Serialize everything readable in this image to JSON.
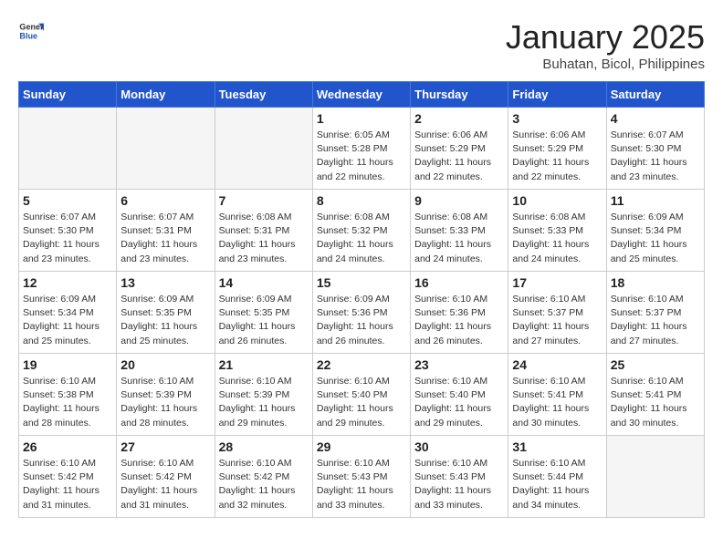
{
  "header": {
    "logo_general": "General",
    "logo_blue": "Blue",
    "title": "January 2025",
    "subtitle": "Buhatan, Bicol, Philippines"
  },
  "weekdays": [
    "Sunday",
    "Monday",
    "Tuesday",
    "Wednesday",
    "Thursday",
    "Friday",
    "Saturday"
  ],
  "weeks": [
    [
      {
        "day": "",
        "info": ""
      },
      {
        "day": "",
        "info": ""
      },
      {
        "day": "",
        "info": ""
      },
      {
        "day": "1",
        "info": "Sunrise: 6:05 AM\nSunset: 5:28 PM\nDaylight: 11 hours\nand 22 minutes."
      },
      {
        "day": "2",
        "info": "Sunrise: 6:06 AM\nSunset: 5:29 PM\nDaylight: 11 hours\nand 22 minutes."
      },
      {
        "day": "3",
        "info": "Sunrise: 6:06 AM\nSunset: 5:29 PM\nDaylight: 11 hours\nand 22 minutes."
      },
      {
        "day": "4",
        "info": "Sunrise: 6:07 AM\nSunset: 5:30 PM\nDaylight: 11 hours\nand 23 minutes."
      }
    ],
    [
      {
        "day": "5",
        "info": "Sunrise: 6:07 AM\nSunset: 5:30 PM\nDaylight: 11 hours\nand 23 minutes."
      },
      {
        "day": "6",
        "info": "Sunrise: 6:07 AM\nSunset: 5:31 PM\nDaylight: 11 hours\nand 23 minutes."
      },
      {
        "day": "7",
        "info": "Sunrise: 6:08 AM\nSunset: 5:31 PM\nDaylight: 11 hours\nand 23 minutes."
      },
      {
        "day": "8",
        "info": "Sunrise: 6:08 AM\nSunset: 5:32 PM\nDaylight: 11 hours\nand 24 minutes."
      },
      {
        "day": "9",
        "info": "Sunrise: 6:08 AM\nSunset: 5:33 PM\nDaylight: 11 hours\nand 24 minutes."
      },
      {
        "day": "10",
        "info": "Sunrise: 6:08 AM\nSunset: 5:33 PM\nDaylight: 11 hours\nand 24 minutes."
      },
      {
        "day": "11",
        "info": "Sunrise: 6:09 AM\nSunset: 5:34 PM\nDaylight: 11 hours\nand 25 minutes."
      }
    ],
    [
      {
        "day": "12",
        "info": "Sunrise: 6:09 AM\nSunset: 5:34 PM\nDaylight: 11 hours\nand 25 minutes."
      },
      {
        "day": "13",
        "info": "Sunrise: 6:09 AM\nSunset: 5:35 PM\nDaylight: 11 hours\nand 25 minutes."
      },
      {
        "day": "14",
        "info": "Sunrise: 6:09 AM\nSunset: 5:35 PM\nDaylight: 11 hours\nand 26 minutes."
      },
      {
        "day": "15",
        "info": "Sunrise: 6:09 AM\nSunset: 5:36 PM\nDaylight: 11 hours\nand 26 minutes."
      },
      {
        "day": "16",
        "info": "Sunrise: 6:10 AM\nSunset: 5:36 PM\nDaylight: 11 hours\nand 26 minutes."
      },
      {
        "day": "17",
        "info": "Sunrise: 6:10 AM\nSunset: 5:37 PM\nDaylight: 11 hours\nand 27 minutes."
      },
      {
        "day": "18",
        "info": "Sunrise: 6:10 AM\nSunset: 5:37 PM\nDaylight: 11 hours\nand 27 minutes."
      }
    ],
    [
      {
        "day": "19",
        "info": "Sunrise: 6:10 AM\nSunset: 5:38 PM\nDaylight: 11 hours\nand 28 minutes."
      },
      {
        "day": "20",
        "info": "Sunrise: 6:10 AM\nSunset: 5:39 PM\nDaylight: 11 hours\nand 28 minutes."
      },
      {
        "day": "21",
        "info": "Sunrise: 6:10 AM\nSunset: 5:39 PM\nDaylight: 11 hours\nand 29 minutes."
      },
      {
        "day": "22",
        "info": "Sunrise: 6:10 AM\nSunset: 5:40 PM\nDaylight: 11 hours\nand 29 minutes."
      },
      {
        "day": "23",
        "info": "Sunrise: 6:10 AM\nSunset: 5:40 PM\nDaylight: 11 hours\nand 29 minutes."
      },
      {
        "day": "24",
        "info": "Sunrise: 6:10 AM\nSunset: 5:41 PM\nDaylight: 11 hours\nand 30 minutes."
      },
      {
        "day": "25",
        "info": "Sunrise: 6:10 AM\nSunset: 5:41 PM\nDaylight: 11 hours\nand 30 minutes."
      }
    ],
    [
      {
        "day": "26",
        "info": "Sunrise: 6:10 AM\nSunset: 5:42 PM\nDaylight: 11 hours\nand 31 minutes."
      },
      {
        "day": "27",
        "info": "Sunrise: 6:10 AM\nSunset: 5:42 PM\nDaylight: 11 hours\nand 31 minutes."
      },
      {
        "day": "28",
        "info": "Sunrise: 6:10 AM\nSunset: 5:42 PM\nDaylight: 11 hours\nand 32 minutes."
      },
      {
        "day": "29",
        "info": "Sunrise: 6:10 AM\nSunset: 5:43 PM\nDaylight: 11 hours\nand 33 minutes."
      },
      {
        "day": "30",
        "info": "Sunrise: 6:10 AM\nSunset: 5:43 PM\nDaylight: 11 hours\nand 33 minutes."
      },
      {
        "day": "31",
        "info": "Sunrise: 6:10 AM\nSunset: 5:44 PM\nDaylight: 11 hours\nand 34 minutes."
      },
      {
        "day": "",
        "info": ""
      }
    ]
  ]
}
